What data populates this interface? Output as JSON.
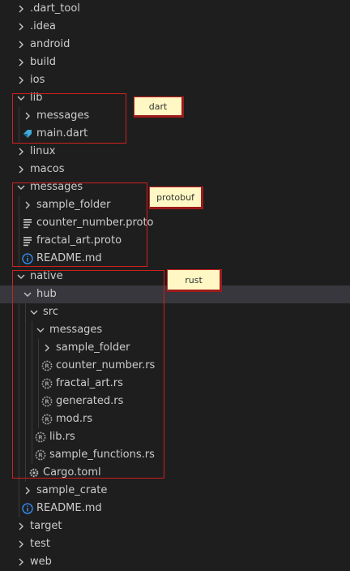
{
  "tree": [
    {
      "label": ".dart_tool",
      "type": "folder",
      "depth": 0,
      "expanded": false,
      "icon": "chevron-right-icon"
    },
    {
      "label": ".idea",
      "type": "folder",
      "depth": 0,
      "expanded": false,
      "icon": "chevron-right-icon"
    },
    {
      "label": "android",
      "type": "folder",
      "depth": 0,
      "expanded": false,
      "icon": "chevron-right-icon"
    },
    {
      "label": "build",
      "type": "folder",
      "depth": 0,
      "expanded": false,
      "icon": "chevron-right-icon"
    },
    {
      "label": "ios",
      "type": "folder",
      "depth": 0,
      "expanded": false,
      "icon": "chevron-right-icon"
    },
    {
      "label": "lib",
      "type": "folder",
      "depth": 0,
      "expanded": true,
      "icon": "chevron-down-icon"
    },
    {
      "label": "messages",
      "type": "folder",
      "depth": 1,
      "expanded": false,
      "icon": "chevron-right-icon"
    },
    {
      "label": "main.dart",
      "type": "file",
      "depth": 1,
      "icon": "dart-file-icon"
    },
    {
      "label": "linux",
      "type": "folder",
      "depth": 0,
      "expanded": false,
      "icon": "chevron-right-icon"
    },
    {
      "label": "macos",
      "type": "folder",
      "depth": 0,
      "expanded": false,
      "icon": "chevron-right-icon"
    },
    {
      "label": "messages",
      "type": "folder",
      "depth": 0,
      "expanded": true,
      "icon": "chevron-down-icon"
    },
    {
      "label": "sample_folder",
      "type": "folder",
      "depth": 1,
      "expanded": false,
      "icon": "chevron-right-icon"
    },
    {
      "label": "counter_number.proto",
      "type": "file",
      "depth": 1,
      "icon": "proto-file-icon"
    },
    {
      "label": "fractal_art.proto",
      "type": "file",
      "depth": 1,
      "icon": "proto-file-icon"
    },
    {
      "label": "README.md",
      "type": "file",
      "depth": 1,
      "icon": "info-icon"
    },
    {
      "label": "native",
      "type": "folder",
      "depth": 0,
      "expanded": true,
      "icon": "chevron-down-icon"
    },
    {
      "label": "hub",
      "type": "folder",
      "depth": 1,
      "expanded": true,
      "icon": "chevron-down-icon",
      "selected": true
    },
    {
      "label": "src",
      "type": "folder",
      "depth": 2,
      "expanded": true,
      "icon": "chevron-down-icon"
    },
    {
      "label": "messages",
      "type": "folder",
      "depth": 3,
      "expanded": true,
      "icon": "chevron-down-icon"
    },
    {
      "label": "sample_folder",
      "type": "folder",
      "depth": 4,
      "expanded": false,
      "icon": "chevron-right-icon"
    },
    {
      "label": "counter_number.rs",
      "type": "file",
      "depth": 4,
      "icon": "rust-file-icon"
    },
    {
      "label": "fractal_art.rs",
      "type": "file",
      "depth": 4,
      "icon": "rust-file-icon"
    },
    {
      "label": "generated.rs",
      "type": "file",
      "depth": 4,
      "icon": "rust-file-icon"
    },
    {
      "label": "mod.rs",
      "type": "file",
      "depth": 4,
      "icon": "rust-file-icon"
    },
    {
      "label": "lib.rs",
      "type": "file",
      "depth": 3,
      "icon": "rust-file-icon"
    },
    {
      "label": "sample_functions.rs",
      "type": "file",
      "depth": 3,
      "icon": "rust-file-icon"
    },
    {
      "label": "Cargo.toml",
      "type": "file",
      "depth": 2,
      "icon": "gear-icon"
    },
    {
      "label": "sample_crate",
      "type": "folder",
      "depth": 1,
      "expanded": false,
      "icon": "chevron-right-icon"
    },
    {
      "label": "README.md",
      "type": "file",
      "depth": 1,
      "icon": "info-icon"
    },
    {
      "label": "target",
      "type": "folder",
      "depth": 0,
      "expanded": false,
      "icon": "chevron-right-icon"
    },
    {
      "label": "test",
      "type": "folder",
      "depth": 0,
      "expanded": false,
      "icon": "chevron-right-icon"
    },
    {
      "label": "web",
      "type": "folder",
      "depth": 0,
      "expanded": false,
      "icon": "chevron-right-icon"
    }
  ],
  "annotations": [
    {
      "id": "dart",
      "label": "dart"
    },
    {
      "id": "protobuf",
      "label": "protobuf"
    },
    {
      "id": "rust",
      "label": "rust"
    }
  ],
  "colors": {
    "background": "#1e1e1e",
    "text": "#cccccc",
    "selected_row": "#37373d",
    "annotation_border": "#d0201e",
    "note_fill": "#fff8c4",
    "dart_icon": "#40a9d6",
    "proto_icon": "#c5c5c5",
    "info_icon": "#3794ff",
    "rust_icon": "#a0a0a0"
  }
}
